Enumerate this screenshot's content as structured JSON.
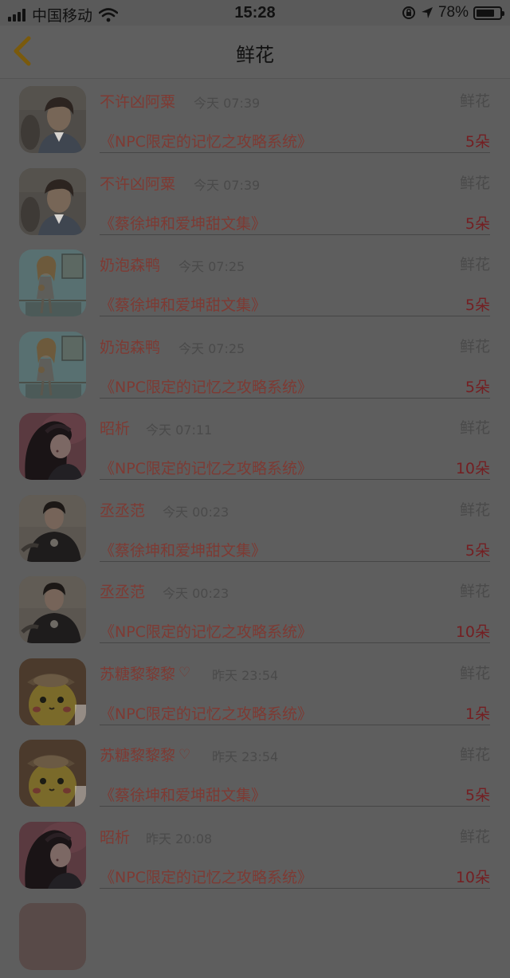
{
  "status_bar": {
    "carrier": "中国移动",
    "time": "15:28",
    "battery": "78%",
    "battery_level": 0.78
  },
  "nav": {
    "title": "鲜花"
  },
  "entries": [
    {
      "name": "不许凶阿粟",
      "heart": false,
      "time": "今天 07:39",
      "type": "鲜花",
      "book": "《NPC限定的记忆之攻略系统》",
      "count": "5朵",
      "avatar": "boy-portrait"
    },
    {
      "name": "不许凶阿粟",
      "heart": false,
      "time": "今天 07:39",
      "type": "鲜花",
      "book": "《蔡徐坤和爱坤甜文集》",
      "count": "5朵",
      "avatar": "boy-portrait"
    },
    {
      "name": "奶泡森鸭",
      "heart": false,
      "time": "今天 07:25",
      "type": "鲜花",
      "book": "《蔡徐坤和爱坤甜文集》",
      "count": "5朵",
      "avatar": "anime-girl"
    },
    {
      "name": "奶泡森鸭",
      "heart": false,
      "time": "今天 07:25",
      "type": "鲜花",
      "book": "《NPC限定的记忆之攻略系统》",
      "count": "5朵",
      "avatar": "anime-girl"
    },
    {
      "name": "昭析",
      "heart": false,
      "time": "今天 07:11",
      "type": "鲜花",
      "book": "《NPC限定的记忆之攻略系统》",
      "count": "10朵",
      "avatar": "woman-portrait"
    },
    {
      "name": "丞丞范",
      "heart": false,
      "time": "今天 00:23",
      "type": "鲜花",
      "book": "《蔡徐坤和爱坤甜文集》",
      "count": "5朵",
      "avatar": "man-black-shirt"
    },
    {
      "name": "丞丞范",
      "heart": false,
      "time": "今天 00:23",
      "type": "鲜花",
      "book": "《NPC限定的记忆之攻略系统》",
      "count": "10朵",
      "avatar": "man-black-shirt"
    },
    {
      "name": "苏糖黎黎黎",
      "heart": true,
      "time": "昨天 23:54",
      "type": "鲜花",
      "book": "《NPC限定的记忆之攻略系统》",
      "count": "1朵",
      "avatar": "pikachu-detective"
    },
    {
      "name": "苏糖黎黎黎",
      "heart": true,
      "time": "昨天 23:54",
      "type": "鲜花",
      "book": "《蔡徐坤和爱坤甜文集》",
      "count": "5朵",
      "avatar": "pikachu-detective"
    },
    {
      "name": "昭析",
      "heart": false,
      "time": "昨天 20:08",
      "type": "鲜花",
      "book": "《NPC限定的记忆之攻略系统》",
      "count": "10朵",
      "avatar": "woman-portrait"
    }
  ],
  "heart_glyph": "♡",
  "colors": {
    "overlay_bg": "#5e5e5e",
    "accent_name": "#7e3a33",
    "accent_count": "#741f22",
    "muted_text": "#4a4a4a",
    "back_chevron": "#7a5a0c"
  }
}
